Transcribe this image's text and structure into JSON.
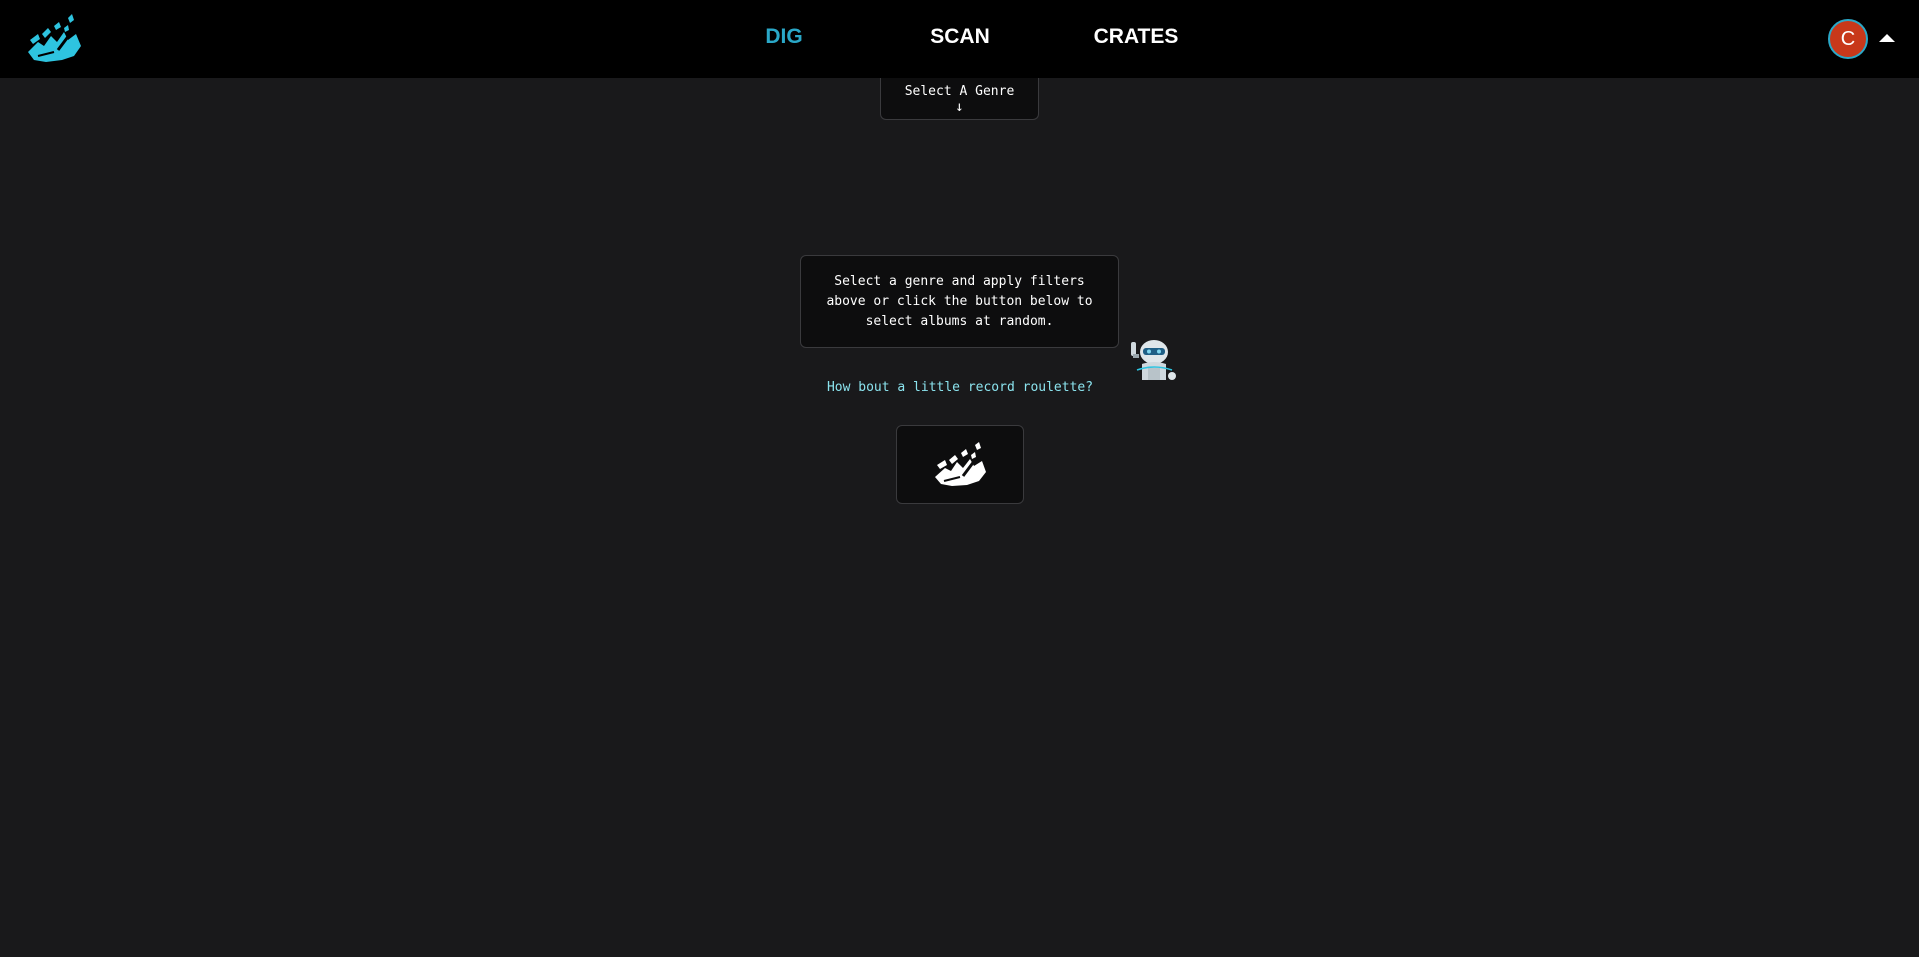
{
  "nav": {
    "items": [
      {
        "label": "DIG",
        "active": true
      },
      {
        "label": "SCAN",
        "active": false
      },
      {
        "label": "CRATES",
        "active": false
      }
    ]
  },
  "user": {
    "avatar_initial": "C"
  },
  "genre_selector": {
    "label": "Select A Genre",
    "arrow": "↓"
  },
  "prompt": {
    "message": "Select a genre and apply filters above or click the button below to select albums at random.",
    "roulette_text": "How bout a little record roulette?"
  },
  "colors": {
    "accent": "#2aa8c8",
    "background": "#19191b",
    "topbar": "#000000",
    "avatar": "#c8381a",
    "roulette_text": "#8be3ee"
  },
  "icons": {
    "logo": "digging-shovel-logo-icon",
    "robot": "waving-robot-icon",
    "roulette": "digging-shovel-icon",
    "menu": "caret-up-icon"
  }
}
